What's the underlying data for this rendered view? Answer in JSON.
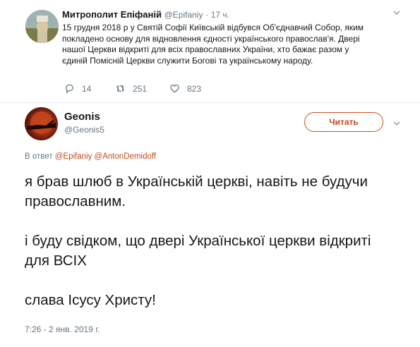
{
  "original_tweet": {
    "name": "Митрополит Епіфаній",
    "handle": "@Epifaniy",
    "separator": "·",
    "time": "17 ч.",
    "text_lines": [
      "15 грудня 2018 р у Святій Софії Київській відбувся Об'єднавчий Собор, яким",
      "покладено основу для відновлення єдності українського православ'я. Двері",
      "нашої Церкви відкриті для всіх православних України, хто бажає разом у",
      "єдиній Помісній Церкви служити Богові та українському народу."
    ],
    "replies": "14",
    "retweets": "251",
    "likes": "823"
  },
  "reply_tweet": {
    "name": "Geonis",
    "handle": "@Geonis5",
    "follow_label": "Читать",
    "reply_prefix": "В ответ",
    "reply_to_1": "@Epifaniy",
    "reply_to_2": "@AntonDemidoff",
    "paragraphs": [
      "я брав шлюб в Українській церкві, навіть не будучи православним.",
      "і буду свідком, що двері Української церкви відкриті для ВСІХ",
      "слава Ісусу Христу!"
    ],
    "timestamp": "7:26 - 2 янв. 2019 г."
  },
  "colors": {
    "accent": "#c64a1d",
    "muted": "#657786",
    "text": "#14171a"
  },
  "icons": [
    "chevron-down-icon",
    "reply-icon",
    "retweet-icon",
    "like-icon"
  ]
}
